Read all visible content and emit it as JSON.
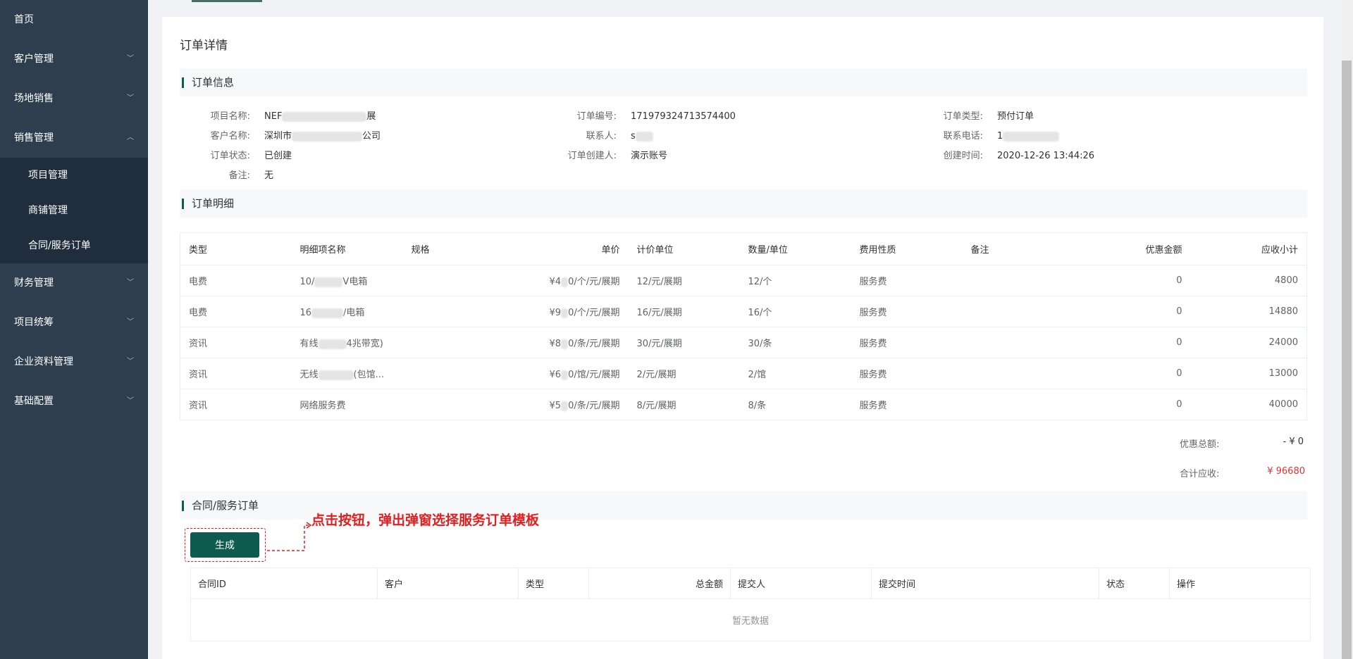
{
  "sidebar": {
    "items": [
      {
        "label": "首页",
        "expandable": false
      },
      {
        "label": "客户管理",
        "expandable": true
      },
      {
        "label": "场地销售",
        "expandable": true
      },
      {
        "label": "销售管理",
        "expandable": true,
        "expanded": true,
        "children": [
          {
            "label": "项目管理"
          },
          {
            "label": "商铺管理"
          },
          {
            "label": "合同/服务订单"
          }
        ]
      },
      {
        "label": "财务管理",
        "expandable": true
      },
      {
        "label": "项目统筹",
        "expandable": true
      },
      {
        "label": "企业资料管理",
        "expandable": true
      },
      {
        "label": "基础配置",
        "expandable": true
      }
    ]
  },
  "page": {
    "title": "订单详情"
  },
  "order_info": {
    "section_title": "订单信息",
    "project_name_label": "项目名称:",
    "project_name_prefix": "NEF",
    "project_name_suffix": "展",
    "order_no_label": "订单编号:",
    "order_no": "171979324713574400",
    "order_type_label": "订单类型:",
    "order_type": "预付订单",
    "customer_label": "客户名称:",
    "customer_prefix": "深圳市",
    "customer_suffix": "公司",
    "contact_label": "联系人:",
    "contact_prefix": "s",
    "phone_label": "联系电话:",
    "phone_prefix": "1",
    "status_label": "订单状态:",
    "status": "已创建",
    "creator_label": "订单创建人:",
    "creator": "演示账号",
    "created_label": "创建时间:",
    "created": "2020-12-26 13:44:26",
    "remark_label": "备注:",
    "remark": "无"
  },
  "order_detail": {
    "section_title": "订单明细",
    "columns": [
      "类型",
      "明细项名称",
      "规格",
      "单价",
      "计价单位",
      "数量/单位",
      "费用性质",
      "备注",
      "优惠金额",
      "应收小计"
    ],
    "rows": [
      {
        "type": "电费",
        "name_a": "10/",
        "name_b": "V电箱",
        "price_a": "¥4",
        "price_b": "0/个/元/展期",
        "unit": "12/元/展期",
        "qty": "12/个",
        "nature": "服务费",
        "discount": "0",
        "subtotal": "4800"
      },
      {
        "type": "电费",
        "name_a": "16",
        "name_b": "/电箱",
        "price_a": "¥9",
        "price_b": "0/个/元/展期",
        "unit": "16/元/展期",
        "qty": "16/个",
        "nature": "服务费",
        "discount": "0",
        "subtotal": "14880"
      },
      {
        "type": "资讯",
        "name_a": "有线",
        "name_b": "4兆带宽)",
        "price_a": "¥8",
        "price_b": "0/条/元/展期",
        "unit": "30/元/展期",
        "qty": "30/条",
        "nature": "服务费",
        "discount": "0",
        "subtotal": "24000"
      },
      {
        "type": "资讯",
        "name_a": "无线",
        "name_b": "(包馆...",
        "price_a": "¥6",
        "price_b": "0/馆/元/展期",
        "unit": "2/元/展期",
        "qty": "2/馆",
        "nature": "服务费",
        "discount": "0",
        "subtotal": "13000"
      },
      {
        "type": "资讯",
        "name_a": "网络服务费",
        "name_b": "",
        "price_a": "¥5",
        "price_b": "0/条/元/展期",
        "unit": "8/元/展期",
        "qty": "8/条",
        "nature": "服务费",
        "discount": "0",
        "subtotal": "40000"
      }
    ],
    "discount_total_label": "优惠总额:",
    "discount_total": "- ¥ 0",
    "total_label": "合计应收:",
    "total": "¥ 96680"
  },
  "contract_section": {
    "section_title": "合同/服务订单",
    "generate_label": "生成",
    "annotation": "点击按钮，弹出弹窗选择服务订单模板",
    "columns": [
      "合同ID",
      "客户",
      "类型",
      "总金额",
      "提交人",
      "提交时间",
      "状态",
      "操作"
    ],
    "empty_text": "暂无数据"
  },
  "colors": {
    "sidebar_bg": "#2e3e4e",
    "submenu_bg": "#1f2d3d",
    "primary": "#0d5c4f",
    "annotation": "#e02020",
    "total": "#f0302f"
  }
}
